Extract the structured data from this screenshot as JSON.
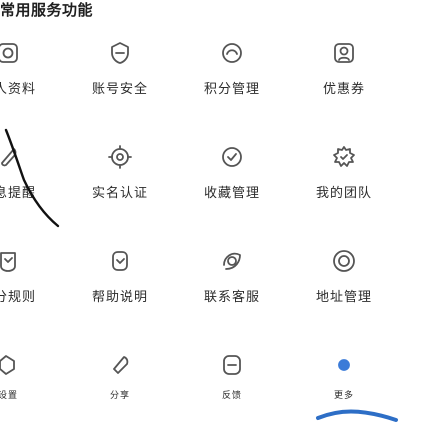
{
  "section": {
    "title": "常用服务功能"
  },
  "grid": {
    "cols_row1": [
      "个人资料",
      "账号安全",
      "积分管理",
      "优惠券"
    ],
    "cols_row2": [
      "消息提醒",
      "实名认证",
      "收藏管理",
      "我的团队"
    ],
    "cols_row3": [
      "积分规则",
      "帮助说明",
      "联系客服",
      "地址管理"
    ],
    "cols_row4": [
      "设置",
      "分享",
      "反馈",
      "更多"
    ]
  },
  "icons": {
    "row1": [
      "photo-icon",
      "shield-icon",
      "points-icon",
      "coupon-icon"
    ],
    "row2": [
      "bell-icon",
      "verify-icon",
      "favorite-icon",
      "team-icon"
    ],
    "row3": [
      "rules-icon",
      "help-icon",
      "service-icon",
      "location-icon"
    ],
    "row4": [
      "settings-icon",
      "share-icon",
      "feedback-icon",
      "more-icon"
    ]
  },
  "colors": {
    "icon": "#555555",
    "text": "#2b2b2b",
    "accent": "#3b7bd8"
  }
}
